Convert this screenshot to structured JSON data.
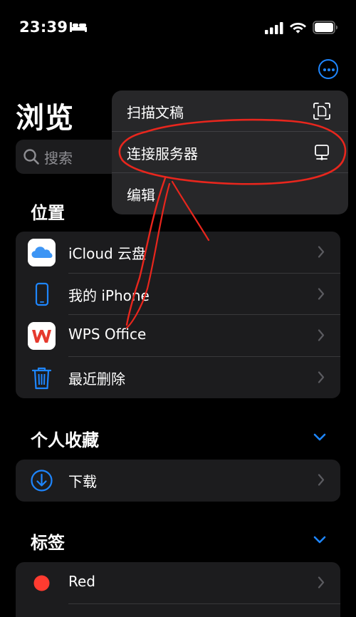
{
  "status": {
    "time": "23:39"
  },
  "header": {
    "title": "浏览"
  },
  "search": {
    "placeholder": "搜索"
  },
  "menu": {
    "items": [
      {
        "label": "扫描文稿"
      },
      {
        "label": "连接服务器"
      },
      {
        "label": "编辑"
      }
    ]
  },
  "locations": {
    "header": "位置",
    "items": [
      {
        "label": "iCloud 云盘"
      },
      {
        "label": "我的 iPhone"
      },
      {
        "label": "WPS Office"
      },
      {
        "label": "最近删除"
      }
    ]
  },
  "favorites": {
    "header": "个人收藏",
    "items": [
      {
        "label": "下载"
      }
    ]
  },
  "tags": {
    "header": "标签",
    "items": [
      {
        "label": "Red",
        "color": "#ff3b30"
      }
    ]
  },
  "colors": {
    "accent": "#1e86ff",
    "background": "#000000",
    "group": "#1c1c1e"
  },
  "icons": [
    "bed-icon",
    "signal-icon",
    "wifi-icon",
    "battery-icon",
    "more-icon",
    "search-icon",
    "scan-document-icon",
    "server-icon",
    "icloud-icon",
    "iphone-icon",
    "wps-icon",
    "trash-icon",
    "download-icon",
    "chevron-right-icon",
    "chevron-down-icon"
  ]
}
